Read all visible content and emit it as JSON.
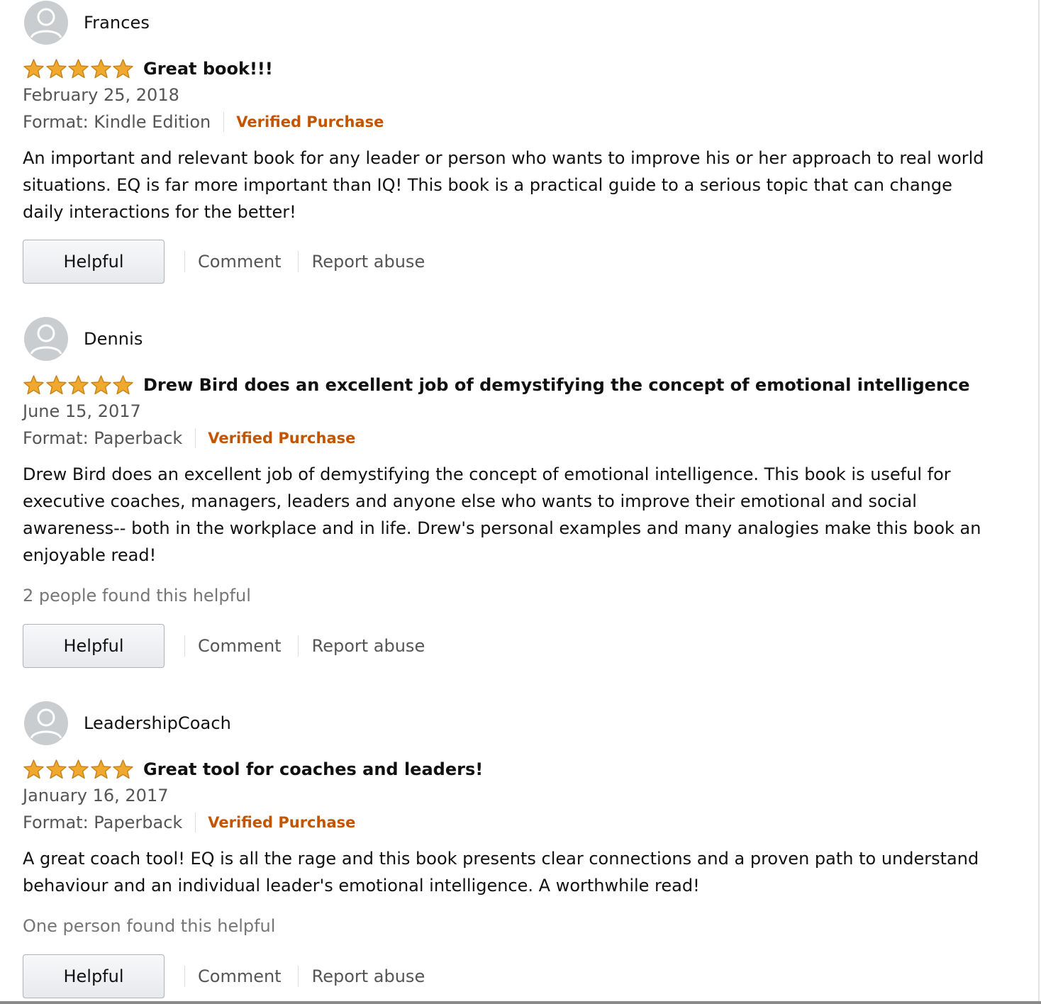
{
  "reviews": [
    {
      "author": "Frances",
      "rating": 5,
      "title": "Great book!!!",
      "date": "February 25, 2018",
      "format": "Format: Kindle Edition",
      "verified": "Verified Purchase",
      "body": "An important and relevant book for any leader or person who wants to improve his or her approach to real world situations. EQ is far more important than IQ! This book is a practical guide to a serious topic that can change daily interactions for the better!",
      "helpful_count": "",
      "helpful_label": "Helpful",
      "comment_label": "Comment",
      "report_label": "Report abuse"
    },
    {
      "author": "Dennis",
      "rating": 5,
      "title": "Drew Bird does an excellent job of demystifying the concept of emotional intelligence",
      "date": "June 15, 2017",
      "format": "Format: Paperback",
      "verified": "Verified Purchase",
      "body": "Drew Bird does an excellent job of demystifying the concept of emotional intelligence. This book is useful for executive coaches, managers, leaders and anyone else who wants to improve their emotional and social awareness-- both in the workplace and in life. Drew's personal examples and many analogies make this book an enjoyable read!",
      "helpful_count": "2 people found this helpful",
      "helpful_label": "Helpful",
      "comment_label": "Comment",
      "report_label": "Report abuse"
    },
    {
      "author": "LeadershipCoach",
      "rating": 5,
      "title": "Great tool for coaches and leaders!",
      "date": "January 16, 2017",
      "format": "Format: Paperback",
      "verified": "Verified Purchase",
      "body": "A great coach tool! EQ is all the rage and this book presents clear connections and a proven path to understand behaviour and an individual leader's emotional intelligence. A worthwhile read!",
      "helpful_count": "One person found this helpful",
      "helpful_label": "Helpful",
      "comment_label": "Comment",
      "report_label": "Report abuse"
    }
  ],
  "icons": {
    "avatar": "user-silhouette-icon",
    "star": "star-filled-icon"
  },
  "colors": {
    "star_fill": "#f0a92f",
    "star_stroke": "#c68114",
    "verified": "#c45500",
    "muted_text": "#555555",
    "helpful_count": "#767676",
    "avatar_bg": "#c9cdd0"
  }
}
